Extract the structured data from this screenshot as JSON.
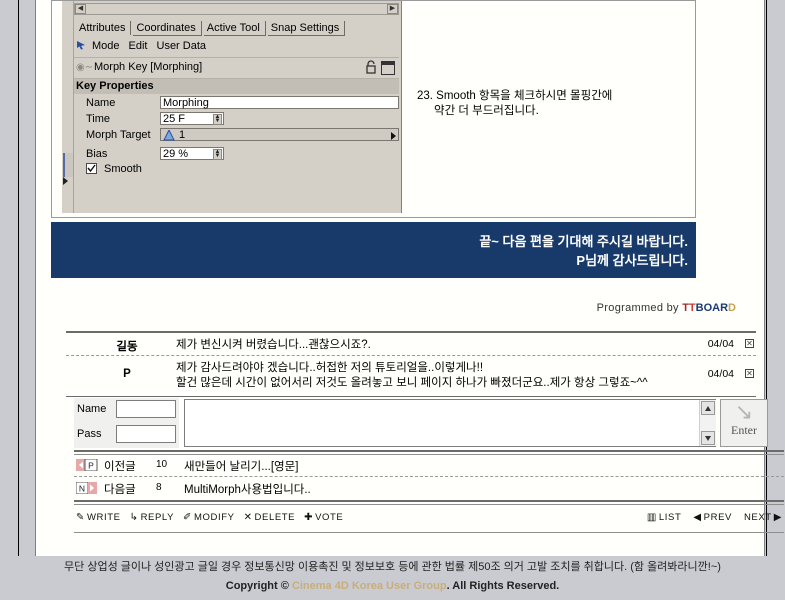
{
  "c4d_panel": {
    "tabs": [
      "Attributes",
      "Coordinates",
      "Active Tool",
      "Snap Settings"
    ],
    "menu": [
      "Mode",
      "Edit",
      "User Data"
    ],
    "object_title": "Morph Key [Morphing]",
    "section_title": "Key Properties",
    "fields": [
      {
        "label": "Name",
        "value": "Morphing"
      },
      {
        "label": "Time",
        "value": "25 F"
      },
      {
        "label": "Morph Target",
        "value": "1"
      },
      {
        "label": "Bias",
        "value": "29 %"
      }
    ],
    "checkbox": {
      "label": "Smooth",
      "checked": true
    }
  },
  "tutorial": {
    "caption_line1": "23. Smooth 항목을 체크하시면 몰핑간에",
    "caption_line2": "약간 더 부드러집니다."
  },
  "banner": {
    "line1": "끝~ 다음 편을 기대해 주시길 바랍니다.",
    "line2": "P님께 감사드립니다."
  },
  "programmed": {
    "prefix": "Programmed by ",
    "brand_t1": "T",
    "brand_t2": "T",
    "brand_boar": "BOAR",
    "brand_d": "D"
  },
  "comments": [
    {
      "author": "길동",
      "lines": [
        "제가 변신시켜 버렸습니다...괜찮으시죠?."
      ],
      "date": "04/04",
      "delete_glyph": "✕"
    },
    {
      "author": "P",
      "lines": [
        "제가 감사드려야야 겠습니다..허접한 저의 튜토리얼을..이렇게나!!",
        "할건 많은데 시간이 없어서리 저것도 올려놓고 보니 페이지 하나가 빠졌더군요..제가 항상 그렇죠~^^"
      ],
      "date": "04/04",
      "delete_glyph": "✕"
    }
  ],
  "reply_form": {
    "name_label": "Name",
    "name_value": "",
    "name_placeholder": "",
    "pass_label": "Pass",
    "pass_value": "",
    "pass_placeholder": "",
    "comment_value": "",
    "comment_placeholder": "",
    "enter_label": "Enter",
    "enter_arrow": "↘"
  },
  "nav": {
    "prev": {
      "tag": "P",
      "label": "이전글",
      "number": "10",
      "title": "새만들어 날리기...[영문]"
    },
    "next": {
      "tag": "N",
      "label": "다음글",
      "number": "8",
      "title": "MultiMorph사용법입니다.."
    }
  },
  "actions": {
    "left": [
      {
        "icon": "pencil-icon",
        "glyph": "✎",
        "label": "WRITE"
      },
      {
        "icon": "reply-arrow-icon",
        "glyph": "↳",
        "label": "REPLY"
      },
      {
        "icon": "note-icon",
        "glyph": "✐",
        "label": "MODIFY"
      },
      {
        "icon": "x-icon",
        "glyph": "✕",
        "label": "DELETE"
      },
      {
        "icon": "plus-icon",
        "glyph": "✚",
        "label": "VOTE"
      }
    ],
    "right": [
      {
        "icon": "list-icon",
        "glyph": "▥",
        "label": "LIST"
      },
      {
        "icon": "prev-triangle-icon",
        "glyph": "◀",
        "label": "PREV"
      },
      {
        "icon": "next-triangle-icon",
        "glyph": "▶",
        "label": "NEXT"
      }
    ]
  },
  "warning": "무단 상업성 글이나 성인광고 글일 경우 정보통신망 이용촉진 및 정보보호 등에 관한 법률 제50조 의거 고발 조치를 취합니다. (함 올려봐라니깐!~)",
  "copyright": {
    "pre": "Copyright © ",
    "site": "Cinema 4D Korea User Group",
    "post": ". All Rights Reserved."
  },
  "colors": {
    "banner_navy": "#173a6b",
    "page_gray": "#c9cbd0",
    "c4d_gray": "#d4d0c8",
    "brand_red": "#9e2b2b",
    "brand_navy": "#1b3a73",
    "brand_gold": "#c8a24a",
    "site_tan": "#c9ad7a",
    "tag_pink": "#e9a7a7"
  }
}
